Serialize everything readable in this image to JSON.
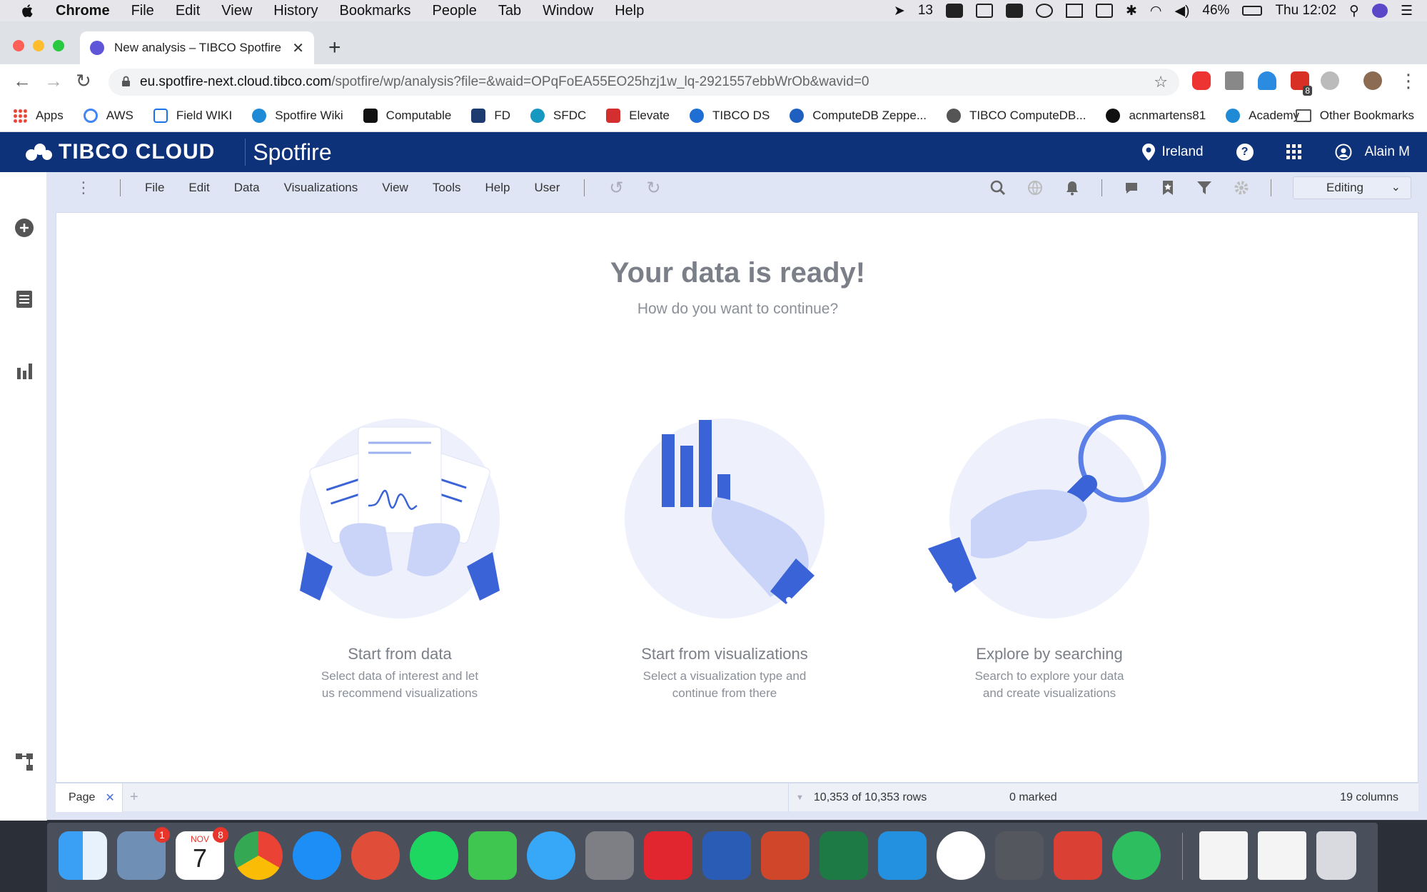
{
  "mac_menubar": {
    "app": "Chrome",
    "items": [
      "File",
      "Edit",
      "View",
      "History",
      "Bookmarks",
      "People",
      "Tab",
      "Window",
      "Help"
    ],
    "status_count": "13",
    "battery": "46%",
    "clock": "Thu 12:02"
  },
  "browser": {
    "tab_title": "New analysis – TIBCO Spotfire",
    "url_host": "eu.spotfire-next.cloud.tibco.com",
    "url_path": "/spotfire/wp/analysis?file=&waid=OPqFoEA55EO25hzj1w_lq-2921557ebbWrOb&wavid=0",
    "ext_badge": "8",
    "bookmarks": [
      {
        "label": "Apps",
        "icon": "apps-grid-icon",
        "color": "#ea4335"
      },
      {
        "label": "AWS",
        "icon": "google-icon",
        "color": "#4285f4"
      },
      {
        "label": "Field WIKI",
        "icon": "wiki-icon",
        "color": "#1a73e8"
      },
      {
        "label": "Spotfire Wiki",
        "icon": "spotfire-icon",
        "color": "#1f8ad6"
      },
      {
        "label": "Computable",
        "icon": "computable-icon",
        "color": "#111111"
      },
      {
        "label": "FD",
        "icon": "fd-icon",
        "color": "#1d3b6e"
      },
      {
        "label": "SFDC",
        "icon": "salesforce-icon",
        "color": "#1798c1"
      },
      {
        "label": "Elevate",
        "icon": "elevate-icon",
        "color": "#d32f2f"
      },
      {
        "label": "TIBCO DS",
        "icon": "tibco-ds-icon",
        "color": "#1f6ed4"
      },
      {
        "label": "ComputeDB Zeppe...",
        "icon": "zeppelin-icon",
        "color": "#1f5fbf"
      },
      {
        "label": "TIBCO ComputeDB...",
        "icon": "globe-icon",
        "color": "#555555"
      },
      {
        "label": "acnmartens81",
        "icon": "github-icon",
        "color": "#111111"
      },
      {
        "label": "Academy",
        "icon": "spotfire-icon",
        "color": "#1f8ad6"
      }
    ],
    "other_bookmarks": "Other Bookmarks"
  },
  "spotfire_header": {
    "logo_text": "TIBCO CLOUD",
    "app_name": "Spotfire",
    "region": "Ireland",
    "user": "Alain M"
  },
  "spotfire_menu": {
    "items": [
      "File",
      "Edit",
      "Data",
      "Visualizations",
      "View",
      "Tools",
      "Help",
      "User"
    ],
    "mode": "Editing"
  },
  "main": {
    "title": "Your data is ready!",
    "subtitle": "How do you want to continue?",
    "cards": [
      {
        "title": "Start from data",
        "desc": "Select data of interest and let us recommend visualizations"
      },
      {
        "title": "Start from visualizations",
        "desc": "Select a visualization type and continue from there"
      },
      {
        "title": "Explore by searching",
        "desc": "Search to explore your data and create visualizations"
      }
    ]
  },
  "statusbar": {
    "page_tab": "Page",
    "rows": "10,353 of 10,353 rows",
    "marked": "0 marked",
    "columns": "19 columns"
  },
  "dock": {
    "badges": {
      "mail": "1",
      "calendar": "8"
    },
    "calendar_month": "NOV",
    "calendar_day": "7"
  },
  "colors": {
    "spotfire_navy": "#0d3279",
    "accent_blue": "#3b63d8",
    "light_lavender": "#eef1fc"
  }
}
